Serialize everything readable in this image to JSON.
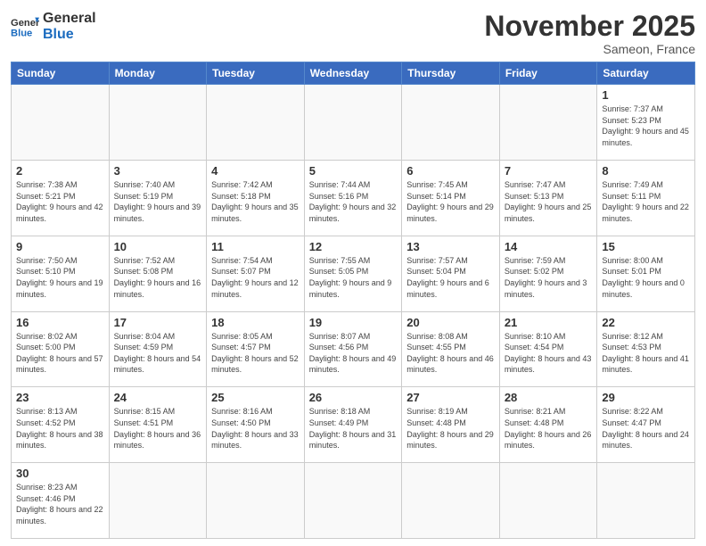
{
  "header": {
    "logo_general": "General",
    "logo_blue": "Blue",
    "month_title": "November 2025",
    "location": "Sameon, France"
  },
  "weekdays": [
    "Sunday",
    "Monday",
    "Tuesday",
    "Wednesday",
    "Thursday",
    "Friday",
    "Saturday"
  ],
  "days": [
    {
      "num": "",
      "info": ""
    },
    {
      "num": "",
      "info": ""
    },
    {
      "num": "",
      "info": ""
    },
    {
      "num": "",
      "info": ""
    },
    {
      "num": "",
      "info": ""
    },
    {
      "num": "",
      "info": ""
    },
    {
      "num": "1",
      "info": "Sunrise: 7:37 AM\nSunset: 5:23 PM\nDaylight: 9 hours and 45 minutes."
    },
    {
      "num": "2",
      "info": "Sunrise: 7:38 AM\nSunset: 5:21 PM\nDaylight: 9 hours and 42 minutes."
    },
    {
      "num": "3",
      "info": "Sunrise: 7:40 AM\nSunset: 5:19 PM\nDaylight: 9 hours and 39 minutes."
    },
    {
      "num": "4",
      "info": "Sunrise: 7:42 AM\nSunset: 5:18 PM\nDaylight: 9 hours and 35 minutes."
    },
    {
      "num": "5",
      "info": "Sunrise: 7:44 AM\nSunset: 5:16 PM\nDaylight: 9 hours and 32 minutes."
    },
    {
      "num": "6",
      "info": "Sunrise: 7:45 AM\nSunset: 5:14 PM\nDaylight: 9 hours and 29 minutes."
    },
    {
      "num": "7",
      "info": "Sunrise: 7:47 AM\nSunset: 5:13 PM\nDaylight: 9 hours and 25 minutes."
    },
    {
      "num": "8",
      "info": "Sunrise: 7:49 AM\nSunset: 5:11 PM\nDaylight: 9 hours and 22 minutes."
    },
    {
      "num": "9",
      "info": "Sunrise: 7:50 AM\nSunset: 5:10 PM\nDaylight: 9 hours and 19 minutes."
    },
    {
      "num": "10",
      "info": "Sunrise: 7:52 AM\nSunset: 5:08 PM\nDaylight: 9 hours and 16 minutes."
    },
    {
      "num": "11",
      "info": "Sunrise: 7:54 AM\nSunset: 5:07 PM\nDaylight: 9 hours and 12 minutes."
    },
    {
      "num": "12",
      "info": "Sunrise: 7:55 AM\nSunset: 5:05 PM\nDaylight: 9 hours and 9 minutes."
    },
    {
      "num": "13",
      "info": "Sunrise: 7:57 AM\nSunset: 5:04 PM\nDaylight: 9 hours and 6 minutes."
    },
    {
      "num": "14",
      "info": "Sunrise: 7:59 AM\nSunset: 5:02 PM\nDaylight: 9 hours and 3 minutes."
    },
    {
      "num": "15",
      "info": "Sunrise: 8:00 AM\nSunset: 5:01 PM\nDaylight: 9 hours and 0 minutes."
    },
    {
      "num": "16",
      "info": "Sunrise: 8:02 AM\nSunset: 5:00 PM\nDaylight: 8 hours and 57 minutes."
    },
    {
      "num": "17",
      "info": "Sunrise: 8:04 AM\nSunset: 4:59 PM\nDaylight: 8 hours and 54 minutes."
    },
    {
      "num": "18",
      "info": "Sunrise: 8:05 AM\nSunset: 4:57 PM\nDaylight: 8 hours and 52 minutes."
    },
    {
      "num": "19",
      "info": "Sunrise: 8:07 AM\nSunset: 4:56 PM\nDaylight: 8 hours and 49 minutes."
    },
    {
      "num": "20",
      "info": "Sunrise: 8:08 AM\nSunset: 4:55 PM\nDaylight: 8 hours and 46 minutes."
    },
    {
      "num": "21",
      "info": "Sunrise: 8:10 AM\nSunset: 4:54 PM\nDaylight: 8 hours and 43 minutes."
    },
    {
      "num": "22",
      "info": "Sunrise: 8:12 AM\nSunset: 4:53 PM\nDaylight: 8 hours and 41 minutes."
    },
    {
      "num": "23",
      "info": "Sunrise: 8:13 AM\nSunset: 4:52 PM\nDaylight: 8 hours and 38 minutes."
    },
    {
      "num": "24",
      "info": "Sunrise: 8:15 AM\nSunset: 4:51 PM\nDaylight: 8 hours and 36 minutes."
    },
    {
      "num": "25",
      "info": "Sunrise: 8:16 AM\nSunset: 4:50 PM\nDaylight: 8 hours and 33 minutes."
    },
    {
      "num": "26",
      "info": "Sunrise: 8:18 AM\nSunset: 4:49 PM\nDaylight: 8 hours and 31 minutes."
    },
    {
      "num": "27",
      "info": "Sunrise: 8:19 AM\nSunset: 4:48 PM\nDaylight: 8 hours and 29 minutes."
    },
    {
      "num": "28",
      "info": "Sunrise: 8:21 AM\nSunset: 4:48 PM\nDaylight: 8 hours and 26 minutes."
    },
    {
      "num": "29",
      "info": "Sunrise: 8:22 AM\nSunset: 4:47 PM\nDaylight: 8 hours and 24 minutes."
    },
    {
      "num": "30",
      "info": "Sunrise: 8:23 AM\nSunset: 4:46 PM\nDaylight: 8 hours and 22 minutes."
    },
    {
      "num": "",
      "info": ""
    },
    {
      "num": "",
      "info": ""
    },
    {
      "num": "",
      "info": ""
    },
    {
      "num": "",
      "info": ""
    },
    {
      "num": "",
      "info": ""
    }
  ]
}
